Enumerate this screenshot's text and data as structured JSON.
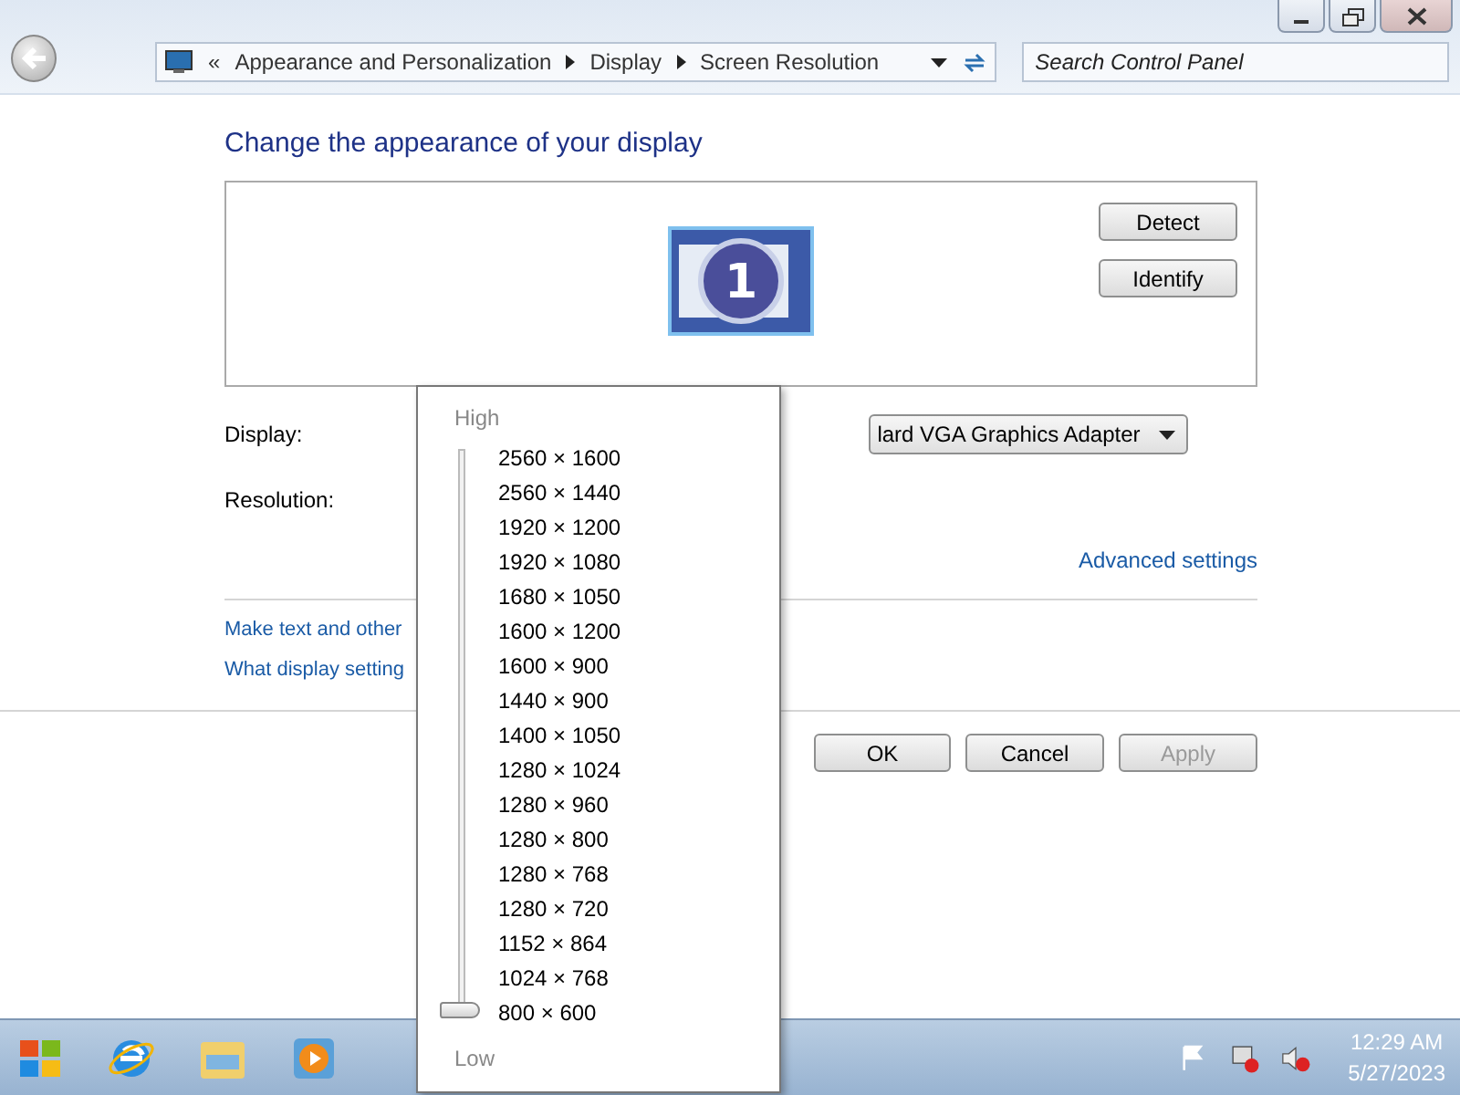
{
  "address_bar": {
    "overflow": "«",
    "crumbs": [
      "Appearance and Personalization",
      "Display",
      "Screen Resolution"
    ]
  },
  "search": {
    "placeholder": "Search Control Panel"
  },
  "heading": "Change the appearance of your display",
  "monitor_preview": {
    "label": "1"
  },
  "preview_buttons": [
    "Detect",
    "Identify"
  ],
  "fields": [
    {
      "label": "Display:",
      "value": "lard VGA Graphics Adapter"
    },
    {
      "label": "Resolution:"
    }
  ],
  "advanced_link": "Advanced settings",
  "links": [
    "Make text and other",
    "What display setting"
  ],
  "dialog_buttons": [
    {
      "label": "OK",
      "disabled": false
    },
    {
      "label": "Cancel",
      "disabled": false
    },
    {
      "label": "Apply",
      "disabled": true
    }
  ],
  "resolution_popup": {
    "high": "High",
    "low": "Low",
    "level": 0,
    "options": [
      "2560 × 1600",
      "2560 × 1440",
      "1920 × 1200",
      "1920 × 1080",
      "1680 × 1050",
      "1600 × 1200",
      "1600 × 900",
      "1440 × 900",
      "1400 × 1050",
      "1280 × 1024",
      "1280 × 960",
      "1280 × 800",
      "1280 × 768",
      "1280 × 720",
      "1152 × 864",
      "1024 × 768",
      "800 × 600"
    ]
  },
  "taskbar": {
    "time": "12:29 AM",
    "date": "5/27/2023"
  }
}
